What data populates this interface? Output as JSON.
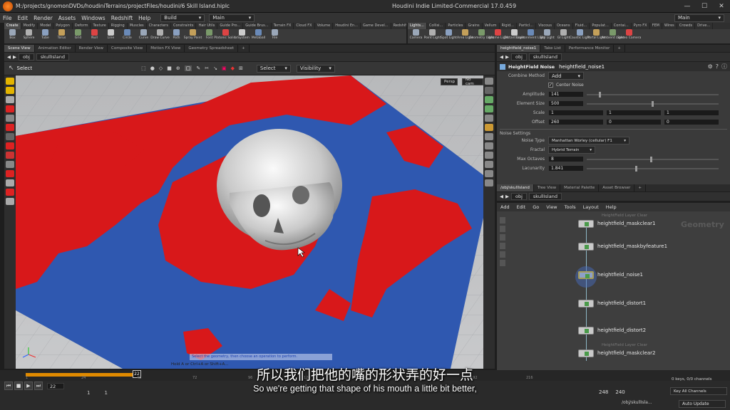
{
  "window": {
    "file_path": "M:/projects/gnomonDVDs/houdiniTerrains/projectFiles/houdini/6 Skill Island.hiplc",
    "title": "Houdini Indie Limited-Commercial 17.0.459",
    "minimize": "—",
    "maximize": "☐",
    "close": "✕"
  },
  "menubar": {
    "items": [
      "File",
      "Edit",
      "Render",
      "Assets",
      "Windows",
      "Redshift",
      "Help"
    ],
    "build_dropdown": "Build",
    "desktop_dropdown": "Main",
    "right_dropdown": "Main"
  },
  "shelf_left": {
    "tabs": [
      "Create",
      "Modify",
      "Model",
      "Polygon",
      "Deform",
      "Texture",
      "Rigging",
      "Muscles",
      "Characters",
      "Constraints",
      "Hair Utils",
      "Guide Pro...",
      "Guide Brus...",
      "Terrain FX",
      "Cloud FX",
      "Volume",
      "Houdini En...",
      "Game Devel...",
      "Redshift"
    ],
    "tools": [
      "Box",
      "Sphere",
      "Tube",
      "Torus",
      "Grid",
      "Null",
      "Line",
      "Circle",
      "Curve",
      "Draw Curve",
      "Path",
      "Spray Paint",
      "Font",
      "Platonic Solids",
      "L-System",
      "Metaball",
      "File"
    ]
  },
  "shelf_right": {
    "tabs": [
      "Lights...",
      "Collisi...",
      "Particles",
      "Grains",
      "Vellum",
      "Rigid...",
      "Particl...",
      "Viscous",
      "Oceans",
      "Fluid...",
      "Populat...",
      "Contai...",
      "Pyro FX",
      "FEM",
      "Wires",
      "Crowds",
      "Drive..."
    ],
    "tools": [
      "Camera",
      "Point Light",
      "Spot Light",
      "Area Light",
      "Geometry Light",
      "Volume Light",
      "Distant Light",
      "Environment Light",
      "Sky Light",
      "GI Light",
      "Caustic Light",
      "Portal Light",
      "Ambient Light",
      "Stereo Camera"
    ]
  },
  "viewer": {
    "tabs": [
      "Scene View",
      "Animation Editor",
      "Render View",
      "Composite View",
      "Motion FX View",
      "Geometry Spreadsheet"
    ],
    "path": [
      "obj",
      "skullIsland"
    ],
    "select_label": "Select",
    "select_dropdown": "Select",
    "visibility_dropdown": "Visibility",
    "persp": "Persp",
    "cam": "No cam",
    "status": "Select the geometry, then choose an operation to perform.",
    "hint": "Hold A or Ctrl+A or Shift+A..."
  },
  "params": {
    "tabs": [
      "heightfield_noise1",
      "Take List",
      "Performance Monitor"
    ],
    "path": [
      "obj",
      "skullIsland"
    ],
    "node_type": "HeightField Noise",
    "node_name": "heightfield_noise1",
    "combine_method_label": "Combine Method",
    "combine_method": "Add",
    "center_noise": "Center Noise",
    "amplitude_label": "Amplitude",
    "amplitude": "141",
    "element_size_label": "Element Size",
    "element_size": "500",
    "scale_label": "Scale",
    "scale": [
      "1",
      "1",
      "1"
    ],
    "offset_label": "Offset",
    "offset": [
      "260",
      "0",
      "0"
    ],
    "noise_settings": "Noise Settings",
    "noise_type_label": "Noise Type",
    "noise_type": "Manhattan Worley (cellular) F1",
    "fractal_label": "Fractal",
    "fractal": "Hybrid Terrain",
    "max_octaves_label": "Max Octaves",
    "max_octaves": "8",
    "lacunarity_label": "Lacunarity",
    "lacunarity": "1.841",
    "sliders": {
      "amplitude": 0.09,
      "element_size": 0.49,
      "max_octaves": 0.48,
      "lacunarity": 0.37
    }
  },
  "network": {
    "tabs": [
      "/obj/skullIsland",
      "Tree View",
      "Material Palette",
      "Asset Browser"
    ],
    "path": [
      "obj",
      "skullIsland"
    ],
    "menu": [
      "Add",
      "Edit",
      "Go",
      "View",
      "Tools",
      "Layout",
      "Help"
    ],
    "watermark": "Geometry",
    "nodes": [
      {
        "sub": "HeightField Layer Clear",
        "name": "heightfield_maskclear1"
      },
      {
        "sub": "",
        "name": "heightfield_maskbyfeature1"
      },
      {
        "sub": "",
        "name": "heightfield_noise1"
      },
      {
        "sub": "",
        "name": "heightfield_distort1"
      },
      {
        "sub": "",
        "name": "heightfield_distort2"
      },
      {
        "sub": "HeightField Layer Clear",
        "name": "heightfield_maskclear2"
      }
    ]
  },
  "timeline": {
    "current_frame": "22",
    "marker": "22",
    "ticks": [
      "1",
      "24",
      "48",
      "72",
      "96",
      "120",
      "144",
      "168",
      "192",
      "216"
    ],
    "start": "1",
    "start2": "1",
    "end": "248",
    "end2": "240",
    "keys": "0 keys, 0/0 channels",
    "key_all": "Key All Channels",
    "auto_update": "Auto Update",
    "status_path": "/obj/skullIsla..."
  },
  "subtitles": {
    "cn": "所以我们把他的嘴的形状弄的好一点",
    "en": "So we're getting that shape of his mouth a little bit better,"
  },
  "colors": {
    "accent": "#f2c200",
    "terrain_red": "#d8181a",
    "terrain_blue": "#2f58b0"
  }
}
